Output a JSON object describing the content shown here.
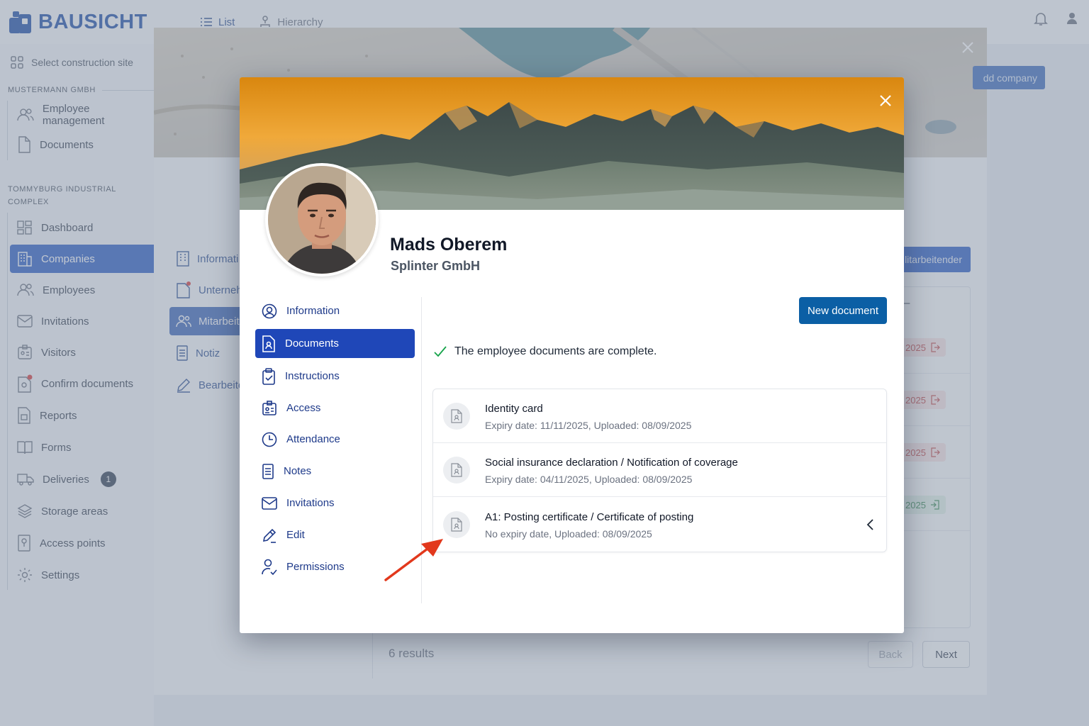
{
  "app": {
    "brand": "BAUSICHT",
    "views": [
      "List",
      "Hierarchy"
    ]
  },
  "sidebar": {
    "site_select": "Select construction site",
    "org_section": "MUSTERMANN GMBH",
    "org_items": [
      {
        "label": "Employee management",
        "icon": "users-icon"
      },
      {
        "label": "Documents",
        "icon": "file-icon"
      }
    ],
    "site_section": "TOMMYBURG INDUSTRIAL COMPLEX",
    "site_items": [
      {
        "label": "Dashboard",
        "icon": "dashboard-icon"
      },
      {
        "label": "Companies",
        "icon": "building-icon",
        "active": true
      },
      {
        "label": "Employees",
        "icon": "users-icon"
      },
      {
        "label": "Invitations",
        "icon": "mail-icon"
      },
      {
        "label": "Visitors",
        "icon": "visitor-badge-icon"
      },
      {
        "label": "Confirm documents",
        "icon": "document-alert-icon"
      },
      {
        "label": "Reports",
        "icon": "report-icon"
      },
      {
        "label": "Forms",
        "icon": "book-icon"
      },
      {
        "label": "Deliveries",
        "icon": "truck-icon",
        "badge": "1"
      },
      {
        "label": "Storage areas",
        "icon": "layers-icon"
      },
      {
        "label": "Access points",
        "icon": "access-point-icon"
      },
      {
        "label": "Settings",
        "icon": "gear-icon"
      }
    ]
  },
  "background_page": {
    "add_company_label": "dd company",
    "tabs": [
      {
        "label": "Informati"
      },
      {
        "label": "Unterneh"
      },
      {
        "label": "Mitarbeit",
        "active": true
      },
      {
        "label": "Notiz"
      },
      {
        "label": "Bearbeite"
      }
    ],
    "employee_button": "litarbeitender",
    "table_dash": "–",
    "row_status": [
      {
        "text": "2025",
        "tone": "red"
      },
      {
        "text": "2025",
        "tone": "red"
      },
      {
        "text": "2025",
        "tone": "red"
      },
      {
        "text": "2025",
        "tone": "green"
      }
    ],
    "results": "6 results",
    "back_label": "Back",
    "next_label": "Next"
  },
  "employee": {
    "name": "Mads Oberem",
    "company": "Splinter GmbH"
  },
  "menu": [
    {
      "label": "Information",
      "icon": "user-circle-icon"
    },
    {
      "label": "Documents",
      "icon": "document-person-icon",
      "active": true
    },
    {
      "label": "Instructions",
      "icon": "clipboard-check-icon"
    },
    {
      "label": "Access",
      "icon": "id-card-icon"
    },
    {
      "label": "Attendance",
      "icon": "clock-icon"
    },
    {
      "label": "Notes",
      "icon": "note-icon"
    },
    {
      "label": "Invitations",
      "icon": "mail-icon"
    },
    {
      "label": "Edit",
      "icon": "pencil-icon"
    },
    {
      "label": "Permissions",
      "icon": "user-check-icon"
    }
  ],
  "documents_panel": {
    "new_document_label": "New document",
    "status_text": "The employee documents are complete.",
    "documents": [
      {
        "title": "Identity card",
        "meta": "Expiry date: 11/11/2025, Uploaded: 08/09/2025"
      },
      {
        "title": "Social insurance declaration / Notification of coverage",
        "meta": "Expiry date: 04/11/2025, Uploaded: 08/09/2025"
      },
      {
        "title": "A1: Posting certificate / Certificate of posting",
        "meta": "No expiry date, Uploaded: 08/09/2025"
      }
    ]
  },
  "colors": {
    "brand": "#1f4fa6",
    "primary": "#1f47b8",
    "new_document": "#0b5fa5",
    "success": "#16a34a",
    "annotation_arrow": "#e2381c"
  }
}
